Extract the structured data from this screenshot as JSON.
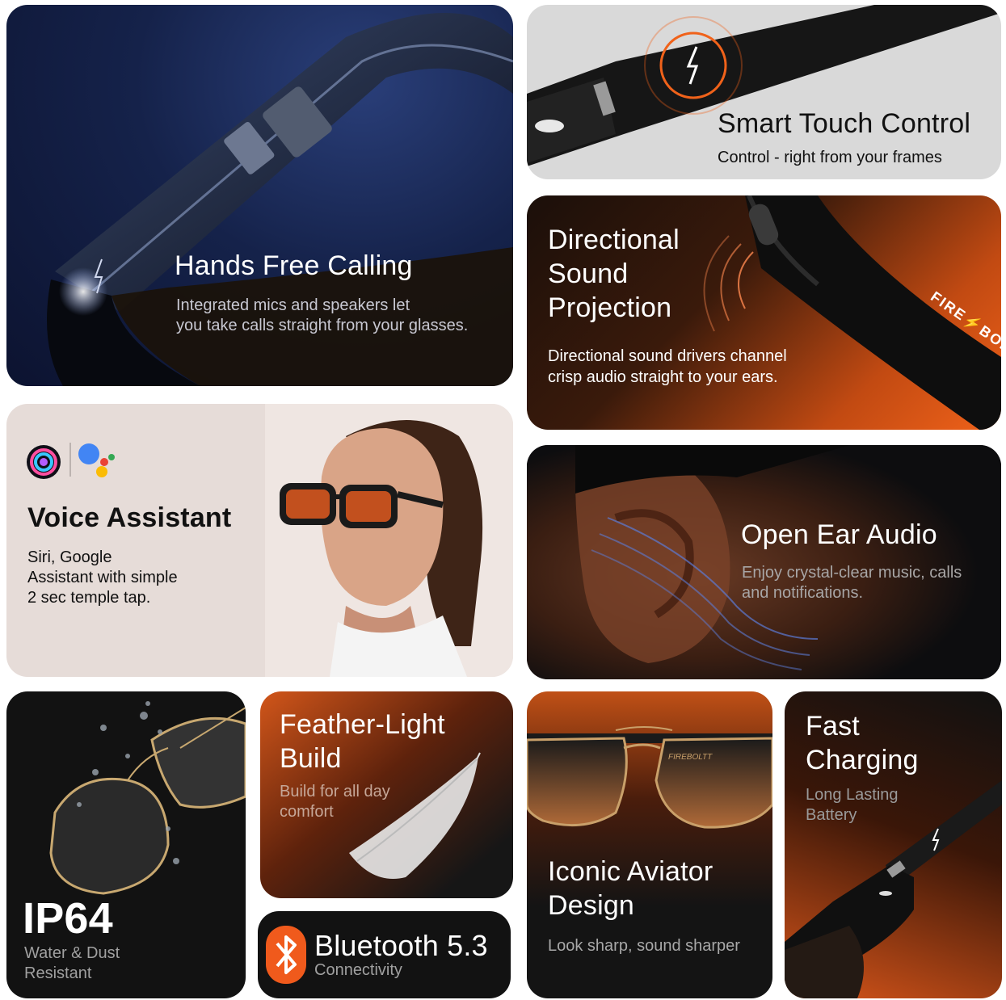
{
  "cards": {
    "hands_free": {
      "title": "Hands Free Calling",
      "desc_line1": "Integrated mics and speakers let",
      "desc_line2": "you take calls straight from your glasses."
    },
    "touch": {
      "title": "Smart Touch Control",
      "desc": "Control - right from your frames"
    },
    "directional": {
      "title_line1": "Directional",
      "title_line2": "Sound",
      "title_line3": "Projection",
      "desc_line1": "Directional sound drivers channel",
      "desc_line2": "crisp audio straight to your ears.",
      "brand": "FIRE⚡BOLT"
    },
    "voice": {
      "title": "Voice Assistant",
      "desc_line1": "Siri, Google",
      "desc_line2": "Assistant with simple",
      "desc_line3": "2 sec temple tap."
    },
    "open_ear": {
      "title": "Open Ear Audio",
      "desc_line1": "Enjoy crystal-clear music, calls",
      "desc_line2": "and notifications."
    },
    "ip64": {
      "title": "IP64",
      "desc_line1": "Water & Dust",
      "desc_line2": "Resistant"
    },
    "feather": {
      "title_line1": "Feather-Light",
      "title_line2": "Build",
      "desc_line1": "Build for all day",
      "desc_line2": "comfort"
    },
    "bluetooth": {
      "title": "Bluetooth 5.3",
      "desc": "Connectivity"
    },
    "aviator": {
      "title_line1": "Iconic Aviator",
      "title_line2": "Design",
      "desc": "Look sharp, sound sharper",
      "brand": "FIREBOLTT"
    },
    "charging": {
      "title_line1": "Fast",
      "title_line2": "Charging",
      "desc_line1": "Long Lasting",
      "desc_line2": "Battery"
    }
  },
  "colors": {
    "accent_orange": "#f0621a",
    "bluetooth_orange": "#f05a1c",
    "navy": "#15224a"
  },
  "icons": [
    "lightning-icon",
    "siri-icon",
    "google-assistant-icon",
    "bluetooth-icon",
    "feather-icon",
    "water-drops-icon"
  ]
}
